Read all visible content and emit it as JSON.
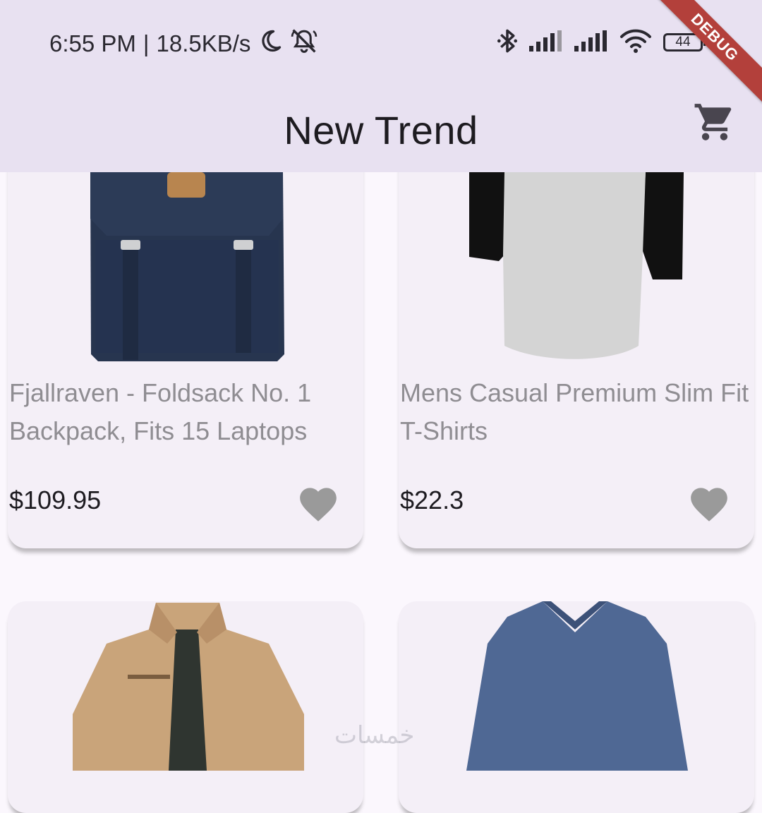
{
  "status_bar": {
    "time": "6:55 PM",
    "separator": "|",
    "network_speed": "18.5KB/s",
    "battery": "44",
    "icons": [
      "moon-icon",
      "bell-off-icon",
      "bluetooth-icon",
      "signal-icon",
      "signal-icon",
      "wifi-icon",
      "battery-icon"
    ]
  },
  "app_bar": {
    "title": "New Trend",
    "cart_icon": "cart-icon",
    "background": "#e8e1f1"
  },
  "debug_banner": "DEBUG",
  "products": [
    {
      "title": "Fjallraven - Foldsack No. 1 Backpack, Fits 15 Laptops",
      "price": "$109.95",
      "image": "backpack",
      "favorite_icon": "heart-icon"
    },
    {
      "title": "Mens Casual Premium Slim Fit T-Shirts",
      "price": "$22.3",
      "image": "raglan-tshirt",
      "favorite_icon": "heart-icon"
    },
    {
      "title": "",
      "price": "",
      "image": "jacket"
    },
    {
      "title": "",
      "price": "",
      "image": "long-sleeve-shirt"
    }
  ],
  "watermark": "خمسات",
  "colors": {
    "page_background": "#fbf7fd",
    "card_background": "#f4eff7",
    "title_text": "#8f8d92",
    "heart": "#9a9a9a",
    "debug_ribbon": "#b3403b"
  }
}
